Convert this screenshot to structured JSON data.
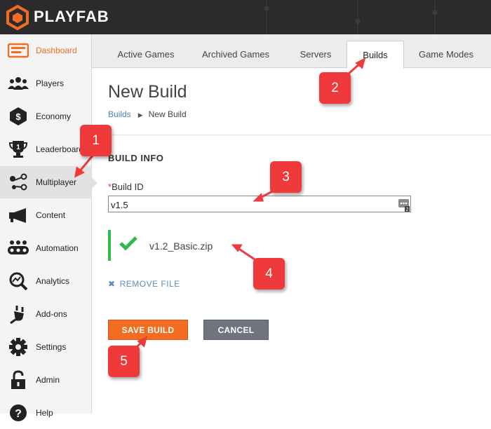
{
  "app": {
    "logo_text": "PLAYFAB"
  },
  "sidebar": {
    "items": [
      {
        "label": "Dashboard",
        "icon": "dashboard-icon"
      },
      {
        "label": "Players",
        "icon": "players-icon"
      },
      {
        "label": "Economy",
        "icon": "economy-icon"
      },
      {
        "label": "Leaderboards",
        "icon": "leaderboards-icon"
      },
      {
        "label": "Multiplayer",
        "icon": "multiplayer-icon"
      },
      {
        "label": "Content",
        "icon": "content-icon"
      },
      {
        "label": "Automation",
        "icon": "automation-icon"
      },
      {
        "label": "Analytics",
        "icon": "analytics-icon"
      },
      {
        "label": "Add-ons",
        "icon": "addons-icon"
      },
      {
        "label": "Settings",
        "icon": "settings-icon"
      },
      {
        "label": "Admin",
        "icon": "admin-icon"
      },
      {
        "label": "Help",
        "icon": "help-icon"
      }
    ]
  },
  "tabs": [
    {
      "label": "Active Games"
    },
    {
      "label": "Archived Games"
    },
    {
      "label": "Servers"
    },
    {
      "label": "Builds"
    },
    {
      "label": "Game Modes"
    }
  ],
  "page": {
    "title": "New Build",
    "breadcrumb": {
      "parent": "Builds",
      "current": "New Build"
    },
    "section_title": "BUILD INFO",
    "build_id": {
      "label": "Build ID",
      "required_mark": "*",
      "value": "v1.5"
    },
    "file_name": "v1.2_Basic.zip",
    "remove_file": "REMOVE FILE",
    "save_label": "SAVE BUILD",
    "cancel_label": "CANCEL"
  },
  "callouts": [
    "1",
    "2",
    "3",
    "4",
    "5"
  ],
  "colors": {
    "accent": "#f26c21",
    "topbar": "#2b2b2d",
    "callout": "#f0393b",
    "success": "#2fbb4a",
    "link": "#4a7fb5"
  }
}
